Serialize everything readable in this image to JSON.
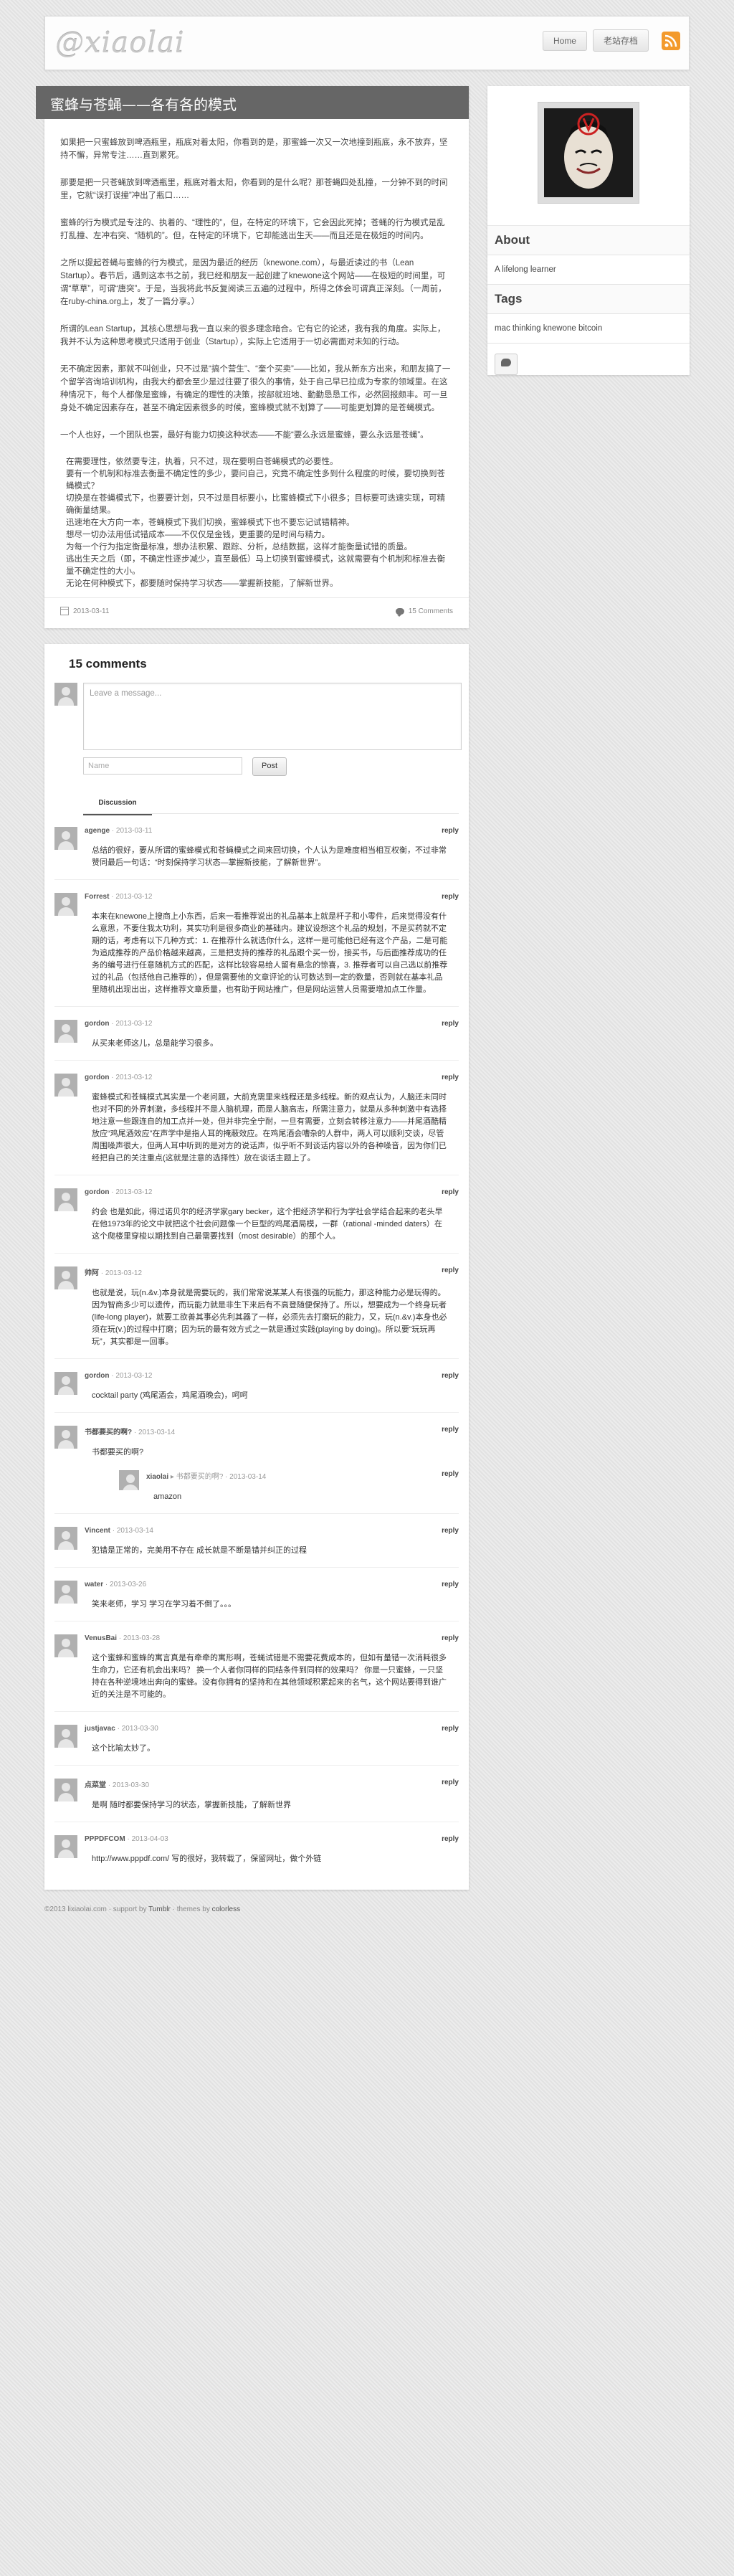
{
  "site": {
    "logo": "@xiaolai"
  },
  "nav": {
    "home": "Home",
    "archive": "老站存档"
  },
  "post": {
    "title": "蜜蜂与苍蝇——各有各的模式",
    "paragraphs": [
      "如果把一只蜜蜂放到啤酒瓶里，瓶底对着太阳，你看到的是，那蜜蜂一次又一次地撞到瓶底，永不放弃，坚持不懈，异常专注……直到累死。",
      "那要是把一只苍蝇放到啤酒瓶里，瓶底对着太阳，你看到的是什么呢？那苍蝇四处乱撞，一分钟不到的时间里，它就“误打误撞”冲出了瓶口……",
      "蜜蜂的行为模式是专注的、执着的、“理性的”，但，在特定的环境下，它会因此死掉；苍蝇的行为模式是乱打乱撞、左冲右突、“随机的”。但，在特定的环境下，它却能逃出生天——而且还是在极短的时间内。",
      "之所以提起苍蝇与蜜蜂的行为模式，是因为最近的经历（knewone.com），与最近读过的书（Lean Startup）。春节后，遇到这本书之前，我已经和朋友一起创建了knewone这个网站——在极短的时间里，可谓“草草”，可谓“唐突”。于是，当我将此书反复阅读三五遍的过程中，所得之体会可谓真正深刻。（一周前，在ruby-china.org上，发了一篇分享。）",
      "所谓的Lean Startup，其核心思想与我一直以来的很多理念暗合。它有它的论述，我有我的角度。实际上，我并不认为这种思考模式只适用于创业（Startup），实际上它适用于一切必需面对未知的行动。",
      "无不确定因素，那就不叫创业，只不过是“搞个营生”、“奎个买卖”——比如，我从新东方出来，和朋友搞了一个留学咨询培训机构，由我大约都会至少是过往要了很久的事情，处于自己早已拉成为专家的领域里。在这种情况下，每个人都像是蜜蜂，有确定的理性的决策，按部就班地、勤勤恳恳工作，必然回报颇丰。可一旦身处不确定因素存在，甚至不确定因素很多的时候，蜜蜂模式就不划算了——可能更划算的是苍蝇模式。",
      "一个人也好，一个团队也罢，最好有能力切换这种状态——不能“要么永远是蜜蜂，要么永远是苍蝇”。"
    ],
    "list_lines": [
      "在需要理性，依然要专注，执着，只不过，现在要明白苍蝇模式的必要性。",
      "要有一个机制和标准去衡量不确定性的多少，要问自己，究竟不确定性多到什么程度的时候，要切换到苍蝇模式？",
      "切换是在苍蝇模式下，也要要计划，只不过是目标要小，比蜜蜂模式下小很多；目标要可迭速实现，可精确衡量结果。",
      "迅速地在大方向一本，苍蝇模式下我们切换，蜜蜂模式下也不要忘记试错精神。",
      "想尽一切办法用低试错成本——不仅仅是金钱，更重要的是时间与精力。",
      "为每一个行为指定衡量标准，想办法积累、跟踪、分析，总结数据，这样才能衡量试错的质量。",
      "逃出生天之后（即，不确定性逐步减少，直至最低）马上切换到蜜蜂模式，这就需要有个机制和标准去衡量不确定性的大小。",
      "无论在何种模式下，都要随时保持学习状态——掌握新技能，了解新世界。"
    ],
    "date": "2013-03-11",
    "comment_count": "15 Comments"
  },
  "comments_section": {
    "title": "15 comments",
    "placeholder": "Leave a message...",
    "name_placeholder": "Name",
    "post_button": "Post",
    "tab": "Discussion",
    "reply_label": "reply",
    "items": [
      {
        "author": "agenge",
        "date": "2013-03-11",
        "text": "总结的很好，要从所谓的蜜蜂模式和苍蝇模式之间来回切换，个人认为是难度相当相互权衡，不过非常赞同最后一句话：“时刻保持学习状态—掌握新技能，了解新世界”。"
      },
      {
        "author": "Forrest",
        "date": "2013-03-12",
        "text": "本来在knewone上搜商上小东西，后来一看推荐说出的礼品基本上就是杆子和小零件，后来觉得没有什么意思，不要住我太功利，其实功利是很多商业的基础内。建议设想这个礼品的规划，不是买药就不定期的话，考虑有以下几种方式：1. 在推荐什么就选你什么，这样一是可能他已经有这个产品，二是可能为追成推荐的产品价格越来越高，三是把支持的推荐的礼品跟个买一份，接买书，与后面推荐成功的任务的编号进行任意随机方式的匹配，这样比较容易给人留有悬念的惊喜，3. 推荐者可以自己选以前推荐过的礼品（包括他自己推荐的），但是需要他的文章评论的认可数达到一定的数量，否则就在基本礼品里随机出现出出，这样推荐文章质量，也有助于网站推广，但是网站运营人员需要增加点工作量。"
      },
      {
        "author": "gordon",
        "date": "2013-03-12",
        "text": "从买来老师这儿，总是能学习很多。"
      },
      {
        "author": "gordon",
        "date": "2013-03-12",
        "text": "蜜蜂模式和苍蝇模式其实是一个老问题，大前克需里来线程还是多线程。新的观点认为，人脑还未同时也对不同的外界刺激，多线程并不是人脑机理，而是人脑高志，所需注意力，就是从多种刺激中有选择地注意一些跟连自的加工点并一处，但并非完全宁耐，一旦有需要，立刻会转移注意力——并尾酒酷精放应“鸡尾酒效应”在声学中是指人耳的掩蔽效应。在鸡尾酒会嘈杂的人群中，两人可以顺利交谈，尽管周围噪声很大，但两人耳中听到的是对方的说话声，似乎听不到谈话内容以外的各种噪音，因为你们已经把自己的关注重点(这就是注意的选择性）放在谈话主题上了。"
      },
      {
        "author": "gordon",
        "date": "2013-03-12",
        "text": "约会 也是如此，得过诺贝尔的经济学家gary becker，这个把经济学和行为学社会学结合起来的老头早在他1973年的论文中就把这个社会问题像一个巨型的鸡尾酒局模，一群（rational -minded daters）在这个爬楼里穿梭以期找到自己最需要找到（most desirable）的那个人。"
      },
      {
        "author": "帅阿",
        "date": "2013-03-12",
        "text": "也就是说，玩(n.&v.)本身就是需要玩的，我们常常说某某人有很强的玩能力，那这种能力必是玩得的。因为智商多少可以遗传，而玩能力就是非生下来后有不高登随便保持了。所以，想要成为一个终身玩者(life-long player)，就要工欲善其事必先利其器了一样，必须先去打磨玩的能力，又，玩(n.&v.)本身也必须在玩(v.)的过程中打磨；因为玩的最有效方式之一就是通过实践(playing by doing)。所以要“玩玩再玩”，其实都是一回事。"
      },
      {
        "author": "gordon",
        "date": "2013-03-12",
        "text": "cocktail party (鸡尾酒会，鸡尾酒晚会)，呵呵"
      },
      {
        "author": "书都要买的啊?",
        "date": "2013-03-14",
        "text": "书都要买的啊?",
        "child": {
          "author": "xiaolai",
          "reply_to": "书都要买的啊?",
          "date": "2013-03-14",
          "text": "amazon"
        }
      },
      {
        "author": "Vincent",
        "date": "2013-03-14",
        "text": "犯错是正常的，完美用不存在 成长就是不断是错并纠正的过程"
      },
      {
        "author": "water",
        "date": "2013-03-26",
        "text": "笑来老师，学习 学习在学习着不倒了。。。"
      },
      {
        "author": "VenusBai",
        "date": "2013-03-28",
        "text": "这个蜜蜂和蜜蜂的寓言真是有牵牵的寓形啊，苍蝇试错是不需要花费成本的，但如有量错一次消耗很多生命力，它还有机会出来吗？ 换一个人者你同样的同结条件到同样的效果吗？ 你是一只蜜蜂，一只坚持在各种逆境地出奔向的蜜蜂。没有你拥有的坚持和在其他领域积累起来的名气，这个网站要得到谁广近的关注是不可能的。"
      },
      {
        "author": "justjavac",
        "date": "2013-03-30",
        "text": "这个比喻太妙了。"
      },
      {
        "author": "点菜堂",
        "date": "2013-03-30",
        "text": "是啊 随时都要保持学习的状态，掌握新技能，了解新世界"
      },
      {
        "author": "PPPDFCOM",
        "date": "2013-04-03",
        "text": "http://www.pppdf.com/ 写的很好，我转载了，保留网址，做个外链"
      }
    ]
  },
  "sidebar": {
    "about_title": "About",
    "about_text": "A lifelong learner",
    "tags_title": "Tags",
    "tags": "mac thinking knewone bitcoin"
  },
  "footer": {
    "copyright": "©2013 lixiaolai.com",
    "support": "support by",
    "support_name": "Tumblr",
    "theme": "themes by",
    "theme_name": "colorless"
  },
  "colors": {
    "accent": "#f39a2c",
    "title_bar": "#666666"
  }
}
